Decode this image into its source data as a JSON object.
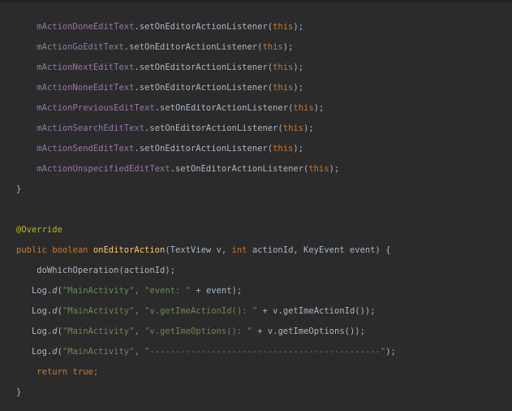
{
  "code": {
    "lines": [
      {
        "indent": "    ",
        "tokens": [
          {
            "t": "mActionDoneEditText",
            "c": "field"
          },
          {
            "t": ".setOnEditorActionListener(",
            "c": "plain"
          },
          {
            "t": "this",
            "c": "kw"
          },
          {
            "t": ");",
            "c": "plain"
          }
        ]
      },
      {
        "indent": "    ",
        "tokens": [
          {
            "t": "mActionGoEditText",
            "c": "field"
          },
          {
            "t": ".setOnEditorActionListener(",
            "c": "plain"
          },
          {
            "t": "this",
            "c": "kw"
          },
          {
            "t": ");",
            "c": "plain"
          }
        ]
      },
      {
        "indent": "    ",
        "tokens": [
          {
            "t": "mActionNextEditText",
            "c": "field"
          },
          {
            "t": ".setOnEditorActionListener(",
            "c": "plain"
          },
          {
            "t": "this",
            "c": "kw"
          },
          {
            "t": ");",
            "c": "plain"
          }
        ]
      },
      {
        "indent": "    ",
        "tokens": [
          {
            "t": "mActionNoneEditText",
            "c": "field"
          },
          {
            "t": ".setOnEditorActionListener(",
            "c": "plain"
          },
          {
            "t": "this",
            "c": "kw"
          },
          {
            "t": ");",
            "c": "plain"
          }
        ]
      },
      {
        "indent": "    ",
        "tokens": [
          {
            "t": "mActionPreviousEditText",
            "c": "field"
          },
          {
            "t": ".setOnEditorActionListener(",
            "c": "plain"
          },
          {
            "t": "this",
            "c": "kw"
          },
          {
            "t": ");",
            "c": "plain"
          }
        ]
      },
      {
        "indent": "    ",
        "tokens": [
          {
            "t": "mActionSearchEditText",
            "c": "field"
          },
          {
            "t": ".setOnEditorActionListener(",
            "c": "plain"
          },
          {
            "t": "this",
            "c": "kw"
          },
          {
            "t": ");",
            "c": "plain"
          }
        ]
      },
      {
        "indent": "    ",
        "tokens": [
          {
            "t": "mActionSendEditText",
            "c": "field"
          },
          {
            "t": ".setOnEditorActionListener(",
            "c": "plain"
          },
          {
            "t": "this",
            "c": "kw"
          },
          {
            "t": ");",
            "c": "plain"
          }
        ]
      },
      {
        "indent": "    ",
        "tokens": [
          {
            "t": "mActionUnspecifiedEditText",
            "c": "field"
          },
          {
            "t": ".setOnEditorActionListener(",
            "c": "plain"
          },
          {
            "t": "this",
            "c": "kw"
          },
          {
            "t": ");",
            "c": "plain"
          }
        ]
      },
      {
        "indent": "",
        "tokens": [
          {
            "t": "}",
            "c": "plain"
          }
        ]
      },
      {
        "indent": "",
        "tokens": []
      },
      {
        "indent": "",
        "tokens": [
          {
            "t": "@Override",
            "c": "ann"
          }
        ]
      },
      {
        "indent": "",
        "tokens": [
          {
            "t": "public boolean ",
            "c": "kw"
          },
          {
            "t": "onEditorAction",
            "c": "fn"
          },
          {
            "t": "(TextView v, ",
            "c": "plain"
          },
          {
            "t": "int ",
            "c": "kw"
          },
          {
            "t": "actionId, KeyEvent event) {",
            "c": "plain"
          }
        ]
      },
      {
        "indent": "    ",
        "tokens": [
          {
            "t": "doWhichOperation(actionId);",
            "c": "plain"
          }
        ]
      },
      {
        "indent": "   ",
        "tokens": [
          {
            "t": "Log.",
            "c": "plain"
          },
          {
            "t": "d",
            "c": "logd"
          },
          {
            "t": "(",
            "c": "plain"
          },
          {
            "t": "\"MainActivity\"",
            "c": "str"
          },
          {
            "t": ", ",
            "c": "kw"
          },
          {
            "t": "\"event: \"",
            "c": "str"
          },
          {
            "t": " + event);",
            "c": "plain"
          }
        ]
      },
      {
        "indent": "   ",
        "tokens": [
          {
            "t": "Log.",
            "c": "plain"
          },
          {
            "t": "d",
            "c": "logd"
          },
          {
            "t": "(",
            "c": "plain"
          },
          {
            "t": "\"MainActivity\"",
            "c": "str"
          },
          {
            "t": ", ",
            "c": "kw"
          },
          {
            "t": "\"v.getImeActionId(): \"",
            "c": "str"
          },
          {
            "t": " + v.getImeActionId());",
            "c": "plain"
          }
        ]
      },
      {
        "indent": "   ",
        "tokens": [
          {
            "t": "Log.",
            "c": "plain"
          },
          {
            "t": "d",
            "c": "logd"
          },
          {
            "t": "(",
            "c": "plain"
          },
          {
            "t": "\"MainActivity\"",
            "c": "str"
          },
          {
            "t": ", ",
            "c": "kw"
          },
          {
            "t": "\"v.getImeOptions(): \"",
            "c": "str"
          },
          {
            "t": " + v.getImeOptions());",
            "c": "plain"
          }
        ]
      },
      {
        "indent": "   ",
        "tokens": [
          {
            "t": "Log.",
            "c": "plain"
          },
          {
            "t": "d",
            "c": "logd"
          },
          {
            "t": "(",
            "c": "plain"
          },
          {
            "t": "\"MainActivity\"",
            "c": "str"
          },
          {
            "t": ", ",
            "c": "kw"
          },
          {
            "t": "\"---------------------------------------------\"",
            "c": "str"
          },
          {
            "t": ");",
            "c": "plain"
          }
        ]
      },
      {
        "indent": "    ",
        "tokens": [
          {
            "t": "return true",
            "c": "kw"
          },
          {
            "t": ";",
            "c": "kw"
          }
        ]
      },
      {
        "indent": "",
        "tokens": [
          {
            "t": "}",
            "c": "plain"
          }
        ]
      }
    ]
  },
  "colors": {
    "background": "#2b2b2b",
    "field": "#9876aa",
    "keyword": "#cc7832",
    "string": "#6a8759",
    "annotation": "#bbb529",
    "method": "#ffc66d",
    "plain": "#a9b7c6"
  }
}
